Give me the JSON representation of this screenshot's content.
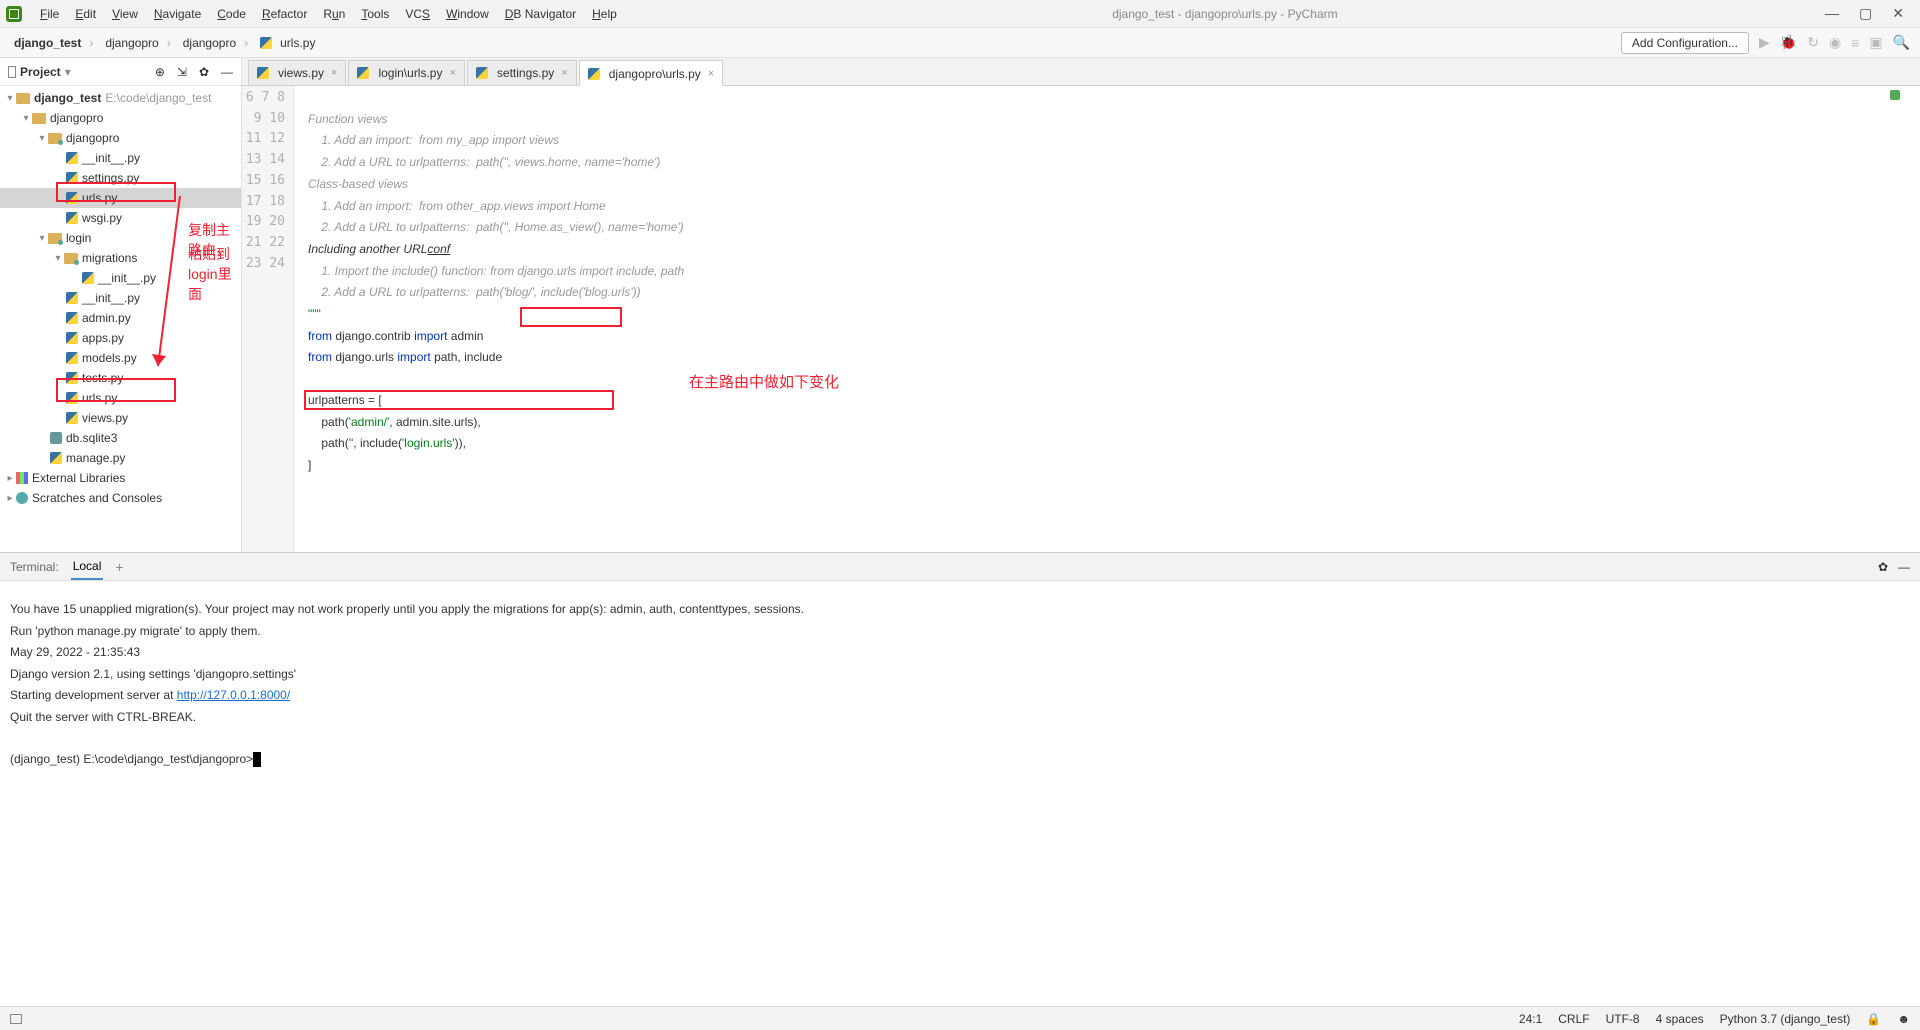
{
  "window": {
    "title": "django_test - djangopro\\urls.py - PyCharm"
  },
  "menu": [
    "File",
    "Edit",
    "View",
    "Navigate",
    "Code",
    "Refactor",
    "Run",
    "Tools",
    "VCS",
    "Window",
    "DB Navigator",
    "Help"
  ],
  "breadcrumbs": [
    "django_test",
    "djangopro",
    "djangopro",
    "urls.py"
  ],
  "toolbar": {
    "add_conf": "Add Configuration..."
  },
  "project_pane": {
    "title": "Project",
    "tree": {
      "root": "django_test",
      "root_path": "E:\\code\\django_test",
      "djangopro": "djangopro",
      "djangopro_inner": "djangopro",
      "init1": "__init__.py",
      "settings": "settings.py",
      "urls1": "urls.py",
      "wsgi": "wsgi.py",
      "login": "login",
      "migrations": "migrations",
      "init_mig": "__init__.py",
      "init2": "__init__.py",
      "admin": "admin.py",
      "apps": "apps.py",
      "models": "models.py",
      "tests": "tests.py",
      "urls2": "urls.py",
      "views": "views.py",
      "dbsqlite": "db.sqlite3",
      "manage": "manage.py",
      "ext_lib": "External Libraries",
      "scratches": "Scratches and Consoles"
    }
  },
  "annotations": {
    "line1": "复制主路由，",
    "line2": "粘贴到login里面",
    "code_note": "在主路由中做如下变化"
  },
  "editor_tabs": [
    {
      "label": "views.py"
    },
    {
      "label": "login\\urls.py"
    },
    {
      "label": "settings.py"
    },
    {
      "label": "djangopro\\urls.py",
      "active": true
    }
  ],
  "gutter_start": 6,
  "gutter_end": 24,
  "code": {
    "l6": "Function views",
    "l7": "    1. Add an import:  from my_app import views",
    "l8": "    2. Add a URL to urlpatterns:  path('', views.home, name='home')",
    "l9": "Class-based views",
    "l10": "    1. Add an import:  from other_app.views import Home",
    "l11": "    2. Add a URL to urlpatterns:  path('', Home.as_view(), name='home')",
    "l12a": "Including another URL",
    "l12b": "conf",
    "l13": "    1. Import the include() function: from django.urls import include, path",
    "l14": "    2. Add a URL to urlpatterns:  path('blog/', include('blog.urls'))",
    "l15": "\"\"\"",
    "l16_from": "from ",
    "l16_mod": "django.contrib ",
    "l16_imp": "import ",
    "l16_id": "admin",
    "l17_from": "from ",
    "l17_mod": "django.urls ",
    "l17_imp": "import ",
    "l17_id": "path, ",
    "l17_inc": "include",
    "l19": "urlpatterns = [",
    "l20a": "    path(",
    "l20b": "'admin/'",
    "l20c": ", admin.site.urls),",
    "l21a": "    path(",
    "l21b": "''",
    "l21c": ", include(",
    "l21d": "'login.urls'",
    "l21e": ")),",
    "l22": "]"
  },
  "terminal": {
    "label": "Terminal:",
    "tab": "Local",
    "lines": {
      "a": "You have 15 unapplied migration(s). Your project may not work properly until you apply the migrations for app(s): admin, auth, contenttypes, sessions.",
      "b": "Run 'python manage.py migrate' to apply them.",
      "c": "May 29, 2022 - 21:35:43",
      "d": "Django version 2.1, using settings 'djangopro.settings'",
      "e": "Starting development server at ",
      "url": "http://127.0.0.1:8000/",
      "f": "Quit the server with CTRL-BREAK.",
      "prompt": "(django_test) E:\\code\\django_test\\djangopro>"
    }
  },
  "status": {
    "pos": "24:1",
    "crlf": "CRLF",
    "enc": "UTF-8",
    "indent": "4 spaces",
    "interp": "Python 3.7 (django_test)"
  }
}
